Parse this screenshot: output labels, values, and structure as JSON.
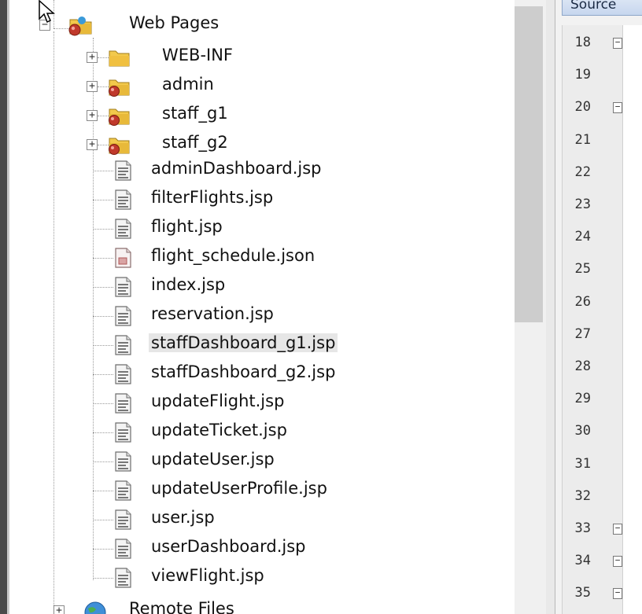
{
  "project_tree": {
    "web_pages": {
      "label": "Web Pages",
      "icon": "web-pages-folder-icon"
    },
    "folders": [
      {
        "label": "WEB-INF",
        "icon": "yellow-folder-icon"
      },
      {
        "label": "admin",
        "icon": "red-web-folder-icon"
      },
      {
        "label": "staff_g1",
        "icon": "red-web-folder-icon"
      },
      {
        "label": "staff_g2",
        "icon": "red-web-folder-icon"
      }
    ],
    "files": [
      {
        "label": "adminDashboard.jsp",
        "icon": "jsp-file-icon"
      },
      {
        "label": "filterFlights.jsp",
        "icon": "jsp-file-icon"
      },
      {
        "label": "flight.jsp",
        "icon": "jsp-file-icon"
      },
      {
        "label": "flight_schedule.json",
        "icon": "json-file-icon"
      },
      {
        "label": "index.jsp",
        "icon": "jsp-file-icon"
      },
      {
        "label": "reservation.jsp",
        "icon": "jsp-file-icon"
      },
      {
        "label": "staffDashboard_g1.jsp",
        "icon": "jsp-file-icon",
        "selected": true
      },
      {
        "label": "staffDashboard_g2.jsp",
        "icon": "jsp-file-icon"
      },
      {
        "label": "updateFlight.jsp",
        "icon": "jsp-file-icon"
      },
      {
        "label": "updateTicket.jsp",
        "icon": "jsp-file-icon"
      },
      {
        "label": "updateUser.jsp",
        "icon": "jsp-file-icon"
      },
      {
        "label": "updateUserProfile.jsp",
        "icon": "jsp-file-icon"
      },
      {
        "label": "user.jsp",
        "icon": "jsp-file-icon"
      },
      {
        "label": "userDashboard.jsp",
        "icon": "jsp-file-icon"
      },
      {
        "label": "viewFlight.jsp",
        "icon": "jsp-file-icon"
      }
    ],
    "remote_files": {
      "label": "Remote Files",
      "icon": "globe-icon"
    }
  },
  "editor": {
    "tab_label": "Source",
    "line_numbers": [
      "18",
      "19",
      "20",
      "21",
      "22",
      "23",
      "24",
      "25",
      "26",
      "27",
      "28",
      "29",
      "30",
      "31",
      "32",
      "33",
      "34",
      "35"
    ]
  },
  "colors": {
    "selection": "#e6e6e6",
    "folder_yellow": "#f2c94c",
    "web_red": "#c0392b",
    "editor_tab": "#c6d6ee"
  }
}
